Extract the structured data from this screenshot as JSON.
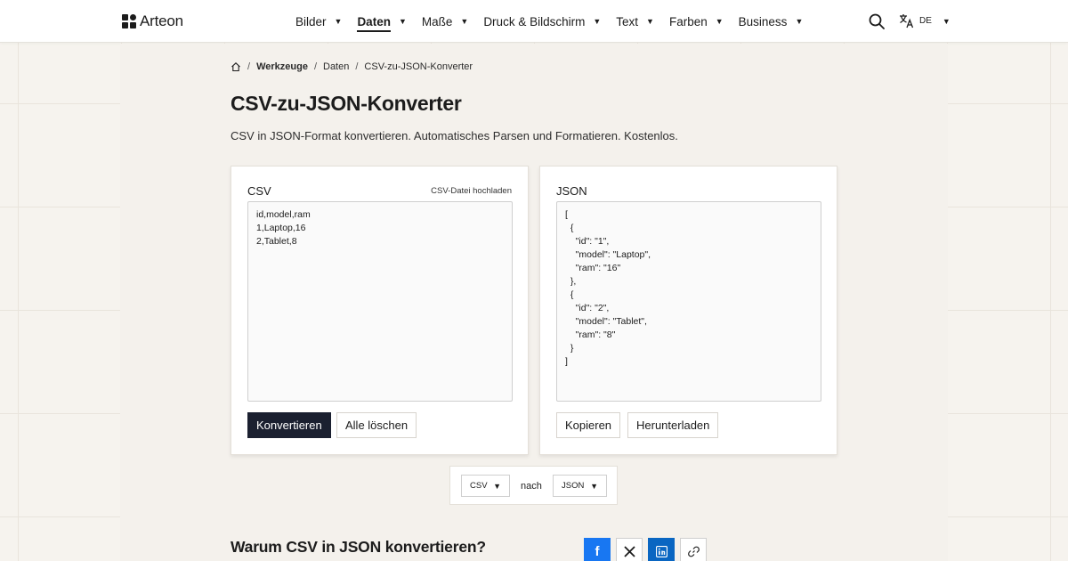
{
  "header": {
    "brand": "Arteon",
    "nav": [
      {
        "label": "Bilder"
      },
      {
        "label": "Daten"
      },
      {
        "label": "Maße"
      },
      {
        "label": "Druck & Bildschirm"
      },
      {
        "label": "Text"
      },
      {
        "label": "Farben"
      },
      {
        "label": "Business"
      }
    ],
    "active_nav": "Daten",
    "language": "DE",
    "caret": "▼"
  },
  "breadcrumb": {
    "sep": "/",
    "items": [
      "Werkzeuge",
      "Daten",
      "CSV-zu-JSON-Konverter"
    ]
  },
  "page": {
    "title": "CSV-zu-JSON-Konverter",
    "description": "CSV in JSON-Format konvertieren. Automatisches Parsen und Formatieren. Kostenlos."
  },
  "input_panel": {
    "label": "CSV",
    "upload_label": "CSV-Datei hochladen",
    "value": "id,model,ram\n1,Laptop,16\n2,Tablet,8",
    "convert_label": "Konvertieren",
    "clear_label": "Alle löschen"
  },
  "output_panel": {
    "label": "JSON",
    "value": "[\n  {\n    \"id\": \"1\",\n    \"model\": \"Laptop\",\n    \"ram\": \"16\"\n  },\n  {\n    \"id\": \"2\",\n    \"model\": \"Tablet\",\n    \"ram\": \"8\"\n  }\n]",
    "copy_label": "Kopieren",
    "download_label": "Herunterladen"
  },
  "format_selector": {
    "from": "CSV",
    "connector": "nach",
    "to": "JSON"
  },
  "section": {
    "title": "Warum CSV in JSON konvertieren?"
  },
  "share": {
    "icons": [
      "facebook-icon",
      "x-icon",
      "linkedin-icon",
      "link-icon"
    ],
    "facebook_letter": "f"
  },
  "colors": {
    "primary_button": "#1b2030",
    "facebook": "#1877f2",
    "linkedin": "#0a66c2"
  }
}
